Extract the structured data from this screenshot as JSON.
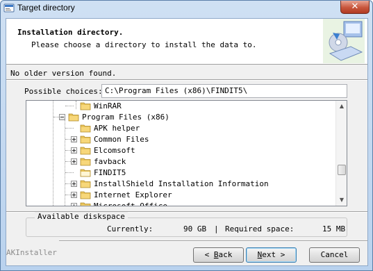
{
  "window": {
    "title": "Target directory",
    "close_glyph": "✕"
  },
  "header": {
    "title": "Installation directory.",
    "subtitle": "Please choose a directory to install the data to."
  },
  "status": "No older version found.",
  "choices": {
    "label": "Possible choices:",
    "path_value": "C:\\Program Files (x86)\\FINDIT5\\"
  },
  "tree": {
    "items": [
      {
        "label": "WinRAR",
        "level": 0,
        "expander": "none",
        "icon": "folder-icon"
      },
      {
        "label": "Program Files (x86)",
        "level": -1,
        "expander": "minus",
        "icon": "folder-icon"
      },
      {
        "label": "APK helper",
        "level": 0,
        "expander": "none",
        "icon": "folder-icon"
      },
      {
        "label": "Common Files",
        "level": 0,
        "expander": "plus",
        "icon": "folder-icon"
      },
      {
        "label": "Elcomsoft",
        "level": 0,
        "expander": "plus",
        "icon": "folder-icon"
      },
      {
        "label": "favback",
        "level": 0,
        "expander": "plus",
        "icon": "folder-icon"
      },
      {
        "label": "FINDIT5",
        "level": 0,
        "expander": "none",
        "icon": "folder-open-icon"
      },
      {
        "label": "InstallShield Installation Information",
        "level": 0,
        "expander": "plus",
        "icon": "folder-icon"
      },
      {
        "label": "Internet Explorer",
        "level": 0,
        "expander": "plus",
        "icon": "folder-icon"
      },
      {
        "label": "Microsoft Office",
        "level": 0,
        "expander": "plus",
        "icon": "folder-icon"
      }
    ],
    "scroll_up": "▲",
    "scroll_down": "▼"
  },
  "diskspace": {
    "title": "Available diskspace",
    "currently_label": "Currently:",
    "currently_value": "90 GB",
    "divider": "|",
    "required_label": "Required space:",
    "required_value": "15 MB"
  },
  "footer": {
    "brand": "AKInstaller",
    "back_prefix": "< ",
    "back_key": "B",
    "back_rest": "ack",
    "next_key": "N",
    "next_rest": "ext >",
    "cancel_label": "Cancel"
  },
  "colors": {
    "title_close": "#c8563c",
    "window_frame": "#b9d2ee",
    "folder": "#e8c35a"
  }
}
